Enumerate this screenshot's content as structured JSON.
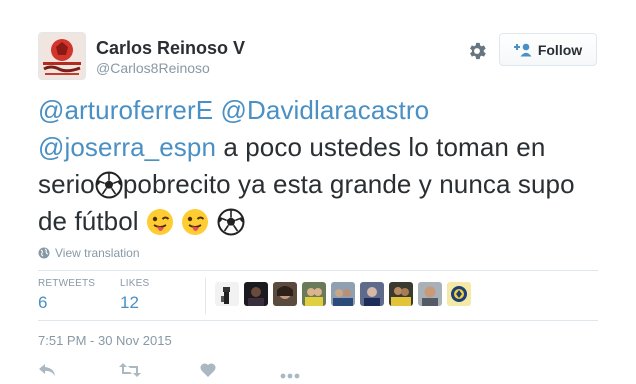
{
  "user": {
    "name": "Carlos Reinoso V",
    "handle": "@Carlos8Reinoso"
  },
  "follow_label": "Follow",
  "tweet": {
    "mention1": "@arturoferrerE",
    "mention2": "@Davidlaracastro",
    "mention3": "@joserra_espn",
    "text1": " a poco ustedes lo toman en serio",
    "text2": "pobrecito ya esta grande y nunca supo de fútbol "
  },
  "view_translation": "View translation",
  "stats": {
    "retweets_label": "RETWEETS",
    "retweets_count": "6",
    "likes_label": "LIKES",
    "likes_count": "12"
  },
  "timestamp": "7:51 PM - 30 Nov 2015",
  "colors": {
    "link": "#4a90c4",
    "muted": "#8899a6",
    "text": "#292f33",
    "border": "#e1e8ed"
  },
  "icons": {
    "gear": "gear-icon",
    "follow": "add-user-icon",
    "globe": "globe-icon",
    "reply": "reply-icon",
    "retweet": "retweet-icon",
    "like": "heart-icon",
    "more": "more-icon"
  }
}
